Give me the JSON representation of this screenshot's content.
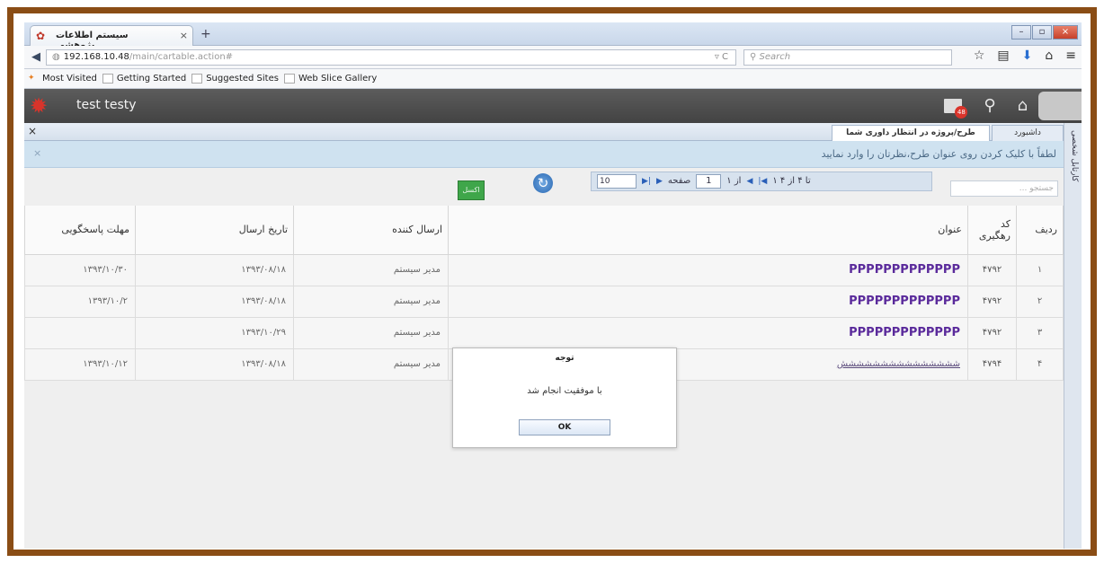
{
  "browser": {
    "tab_title": "سیستم اطلاعات پژوهشی",
    "url_host": "192.168.10.48",
    "url_path": "/main/cartable.action#",
    "search_placeholder": "Search",
    "bookmarks": [
      "Most Visited",
      "Getting Started",
      "Suggested Sites",
      "Web Slice Gallery"
    ]
  },
  "app": {
    "username": "test testy",
    "mail_badge": "48"
  },
  "side_tab": "کارتابل شخصی",
  "panel_tabs": [
    {
      "label": "داشبورد"
    },
    {
      "label": "طرح/پروژه در انتظار داوری شما"
    }
  ],
  "notice": "لطفاً با کلیک کردن روی عنوان طرح،نظرتان را وارد نمایید",
  "toolbar": {
    "search_placeholder": "جستجو ...",
    "page_size": "10",
    "page_label": "صفحه",
    "page_value": "1",
    "page_of": "از ۱",
    "range_text": "۱ تا ۴ از ۴",
    "excel_label": "اکسل"
  },
  "table": {
    "headers": [
      "ردیف",
      "کد رهگیری",
      "عنوان",
      "ارسال کننده",
      "تاریخ ارسال",
      "مهلت پاسخگویی"
    ],
    "rows": [
      {
        "num": "۱",
        "code": "۴۷۹۲",
        "title": "PPPPPPPPPPPPP",
        "sender": "مدیر سیستم",
        "sent": "۱۳۹۳/۰۸/۱۸",
        "deadline": "۱۳۹۳/۱۰/۳۰"
      },
      {
        "num": "۲",
        "code": "۴۷۹۲",
        "title": "PPPPPPPPPPPPP",
        "sender": "مدیر سیستم",
        "sent": "۱۳۹۳/۰۸/۱۸",
        "deadline": "۱۳۹۳/۱۰/۲"
      },
      {
        "num": "۳",
        "code": "۴۷۹۲",
        "title": "PPPPPPPPPPPPP",
        "sender": "مدیر سیستم",
        "sent": "۱۳۹۳/۱۰/۲۹",
        "deadline": ""
      },
      {
        "num": "۴",
        "code": "۴۷۹۴",
        "title": "ششششششششششششششش",
        "sender": "مدیر سیستم",
        "sent": "۱۳۹۳/۰۸/۱۸",
        "deadline": "۱۳۹۳/۱۰/۱۲"
      }
    ]
  },
  "modal": {
    "title": "توجه",
    "message": "با موفقیت انجام شد",
    "ok_label": "OK"
  }
}
